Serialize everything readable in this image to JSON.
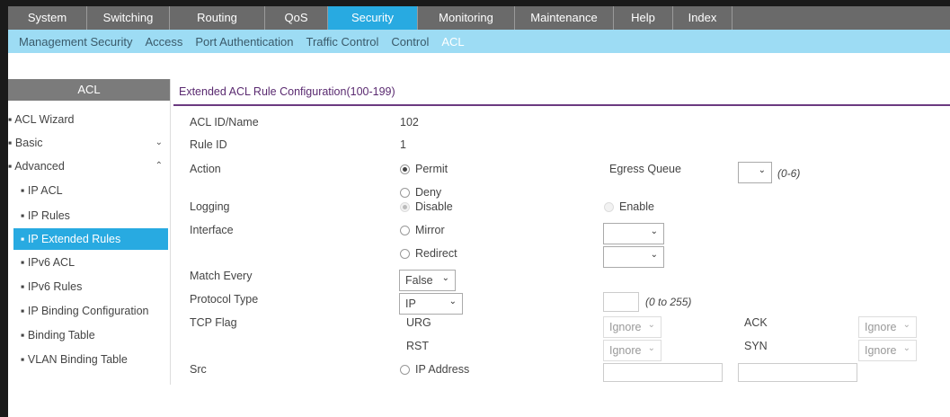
{
  "top_nav": [
    "System",
    "Switching",
    "Routing",
    "QoS",
    "Security",
    "Monitoring",
    "Maintenance",
    "Help",
    "Index"
  ],
  "sub_nav": [
    "Management Security",
    "Access",
    "Port Authentication",
    "Traffic Control",
    "Control",
    "ACL"
  ],
  "sidebar": {
    "header": "ACL",
    "items": [
      "ACL Wizard",
      "Basic",
      "Advanced",
      "IP ACL",
      "IP Rules",
      "IP Extended Rules",
      "IPv6 ACL",
      "IPv6 Rules",
      "IP Binding Configuration",
      "Binding Table",
      "VLAN Binding Table"
    ]
  },
  "content": {
    "title": "Extended ACL Rule Configuration(100-199)",
    "acl_id_label": "ACL ID/Name",
    "acl_id_value": "102",
    "rule_id_label": "Rule ID",
    "rule_id_value": "1",
    "action_label": "Action",
    "permit": "Permit",
    "deny": "Deny",
    "egress_label": "Egress Queue",
    "egress_hint": "(0-6)",
    "logging_label": "Logging",
    "disable": "Disable",
    "enable": "Enable",
    "interface_label": "Interface",
    "mirror": "Mirror",
    "redirect": "Redirect",
    "match_every_label": "Match Every",
    "match_every_value": "False",
    "protocol_label": "Protocol Type",
    "protocol_value": "IP",
    "protocol_hint": "(0 to 255)",
    "tcp_flag_label": "TCP Flag",
    "urg": "URG",
    "ack": "ACK",
    "rst": "RST",
    "syn": "SYN",
    "ignore": "Ignore",
    "src_label": "Src",
    "ip_address": "IP Address"
  },
  "colors": {
    "active_tab": "#28aae1",
    "subnav_bg": "#9ddcf4",
    "nav_bg": "#6a6a6a",
    "title_purple": "#5a2a70"
  }
}
